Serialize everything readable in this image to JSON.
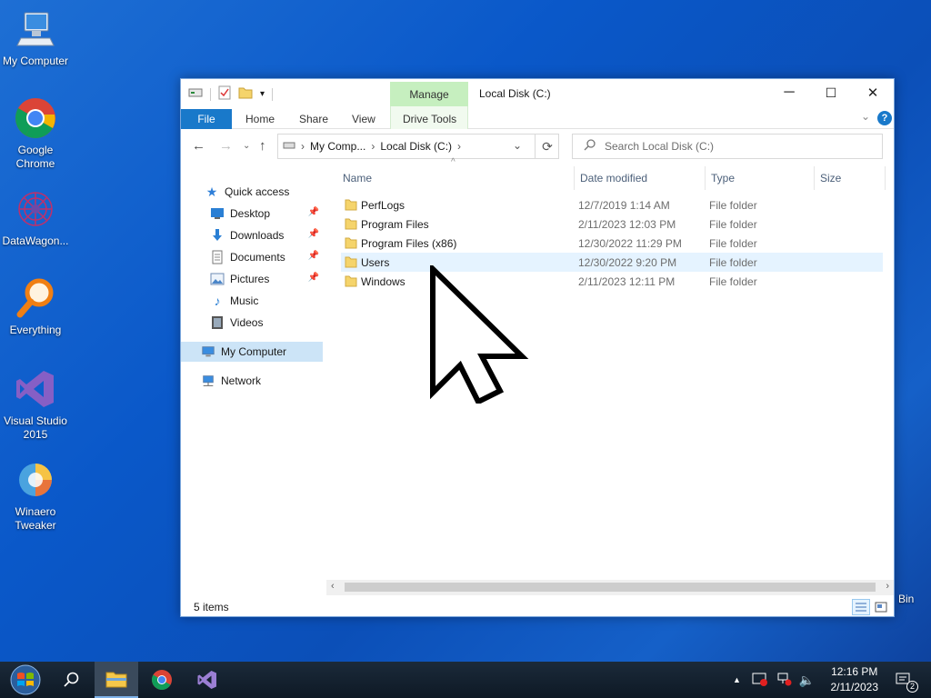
{
  "desktop": {
    "icons": [
      {
        "label": "My Computer",
        "icon": "computer-icon"
      },
      {
        "label": "Google Chrome",
        "icon": "chrome-icon"
      },
      {
        "label": "DataWagon...",
        "icon": "datawagon-icon"
      },
      {
        "label": "Everything",
        "icon": "everything-search-icon"
      },
      {
        "label": "Visual Studio 2015",
        "icon": "visual-studio-icon"
      },
      {
        "label": "Winaero Tweaker",
        "icon": "winaero-icon"
      }
    ],
    "recycle_bin_partial": "Bin"
  },
  "window": {
    "title": "Local Disk (C:)",
    "contextual_tab": "Manage",
    "controls": {
      "minimize": "─",
      "maximize": "☐",
      "close": "✕"
    },
    "ribbon_tabs": [
      "File",
      "Home",
      "Share",
      "View",
      "Drive Tools"
    ],
    "help": "?",
    "address": {
      "crumbs": [
        "My Comp...",
        "Local Disk (C:)"
      ],
      "search_placeholder": "Search Local Disk (C:)"
    },
    "nav": {
      "quick_access": "Quick access",
      "items": [
        {
          "label": "Desktop",
          "pinned": true,
          "icon": "desktop-icon"
        },
        {
          "label": "Downloads",
          "pinned": true,
          "icon": "downloads-icon"
        },
        {
          "label": "Documents",
          "pinned": true,
          "icon": "documents-icon"
        },
        {
          "label": "Pictures",
          "pinned": true,
          "icon": "pictures-icon"
        },
        {
          "label": "Music",
          "pinned": false,
          "icon": "music-icon"
        },
        {
          "label": "Videos",
          "pinned": false,
          "icon": "videos-icon"
        }
      ],
      "my_computer": "My Computer",
      "network": "Network"
    },
    "columns": {
      "name": "Name",
      "date": "Date modified",
      "type": "Type",
      "size": "Size"
    },
    "files": [
      {
        "name": "PerfLogs",
        "date": "12/7/2019 1:14 AM",
        "type": "File folder"
      },
      {
        "name": "Program Files",
        "date": "2/11/2023 12:03 PM",
        "type": "File folder"
      },
      {
        "name": "Program Files (x86)",
        "date": "12/30/2022 11:29 PM",
        "type": "File folder"
      },
      {
        "name": "Users",
        "date": "12/30/2022 9:20 PM",
        "type": "File folder"
      },
      {
        "name": "Windows",
        "date": "2/11/2023 12:11 PM",
        "type": "File folder"
      }
    ],
    "status": "5 items"
  },
  "taskbar": {
    "clock_time": "12:16 PM",
    "clock_date": "2/11/2023",
    "notification_count": "2"
  },
  "colors": {
    "accent": "#1979ca",
    "manage_tab": "#c6efbf",
    "selection": "#cce4f7",
    "hover": "#e5f3ff"
  }
}
